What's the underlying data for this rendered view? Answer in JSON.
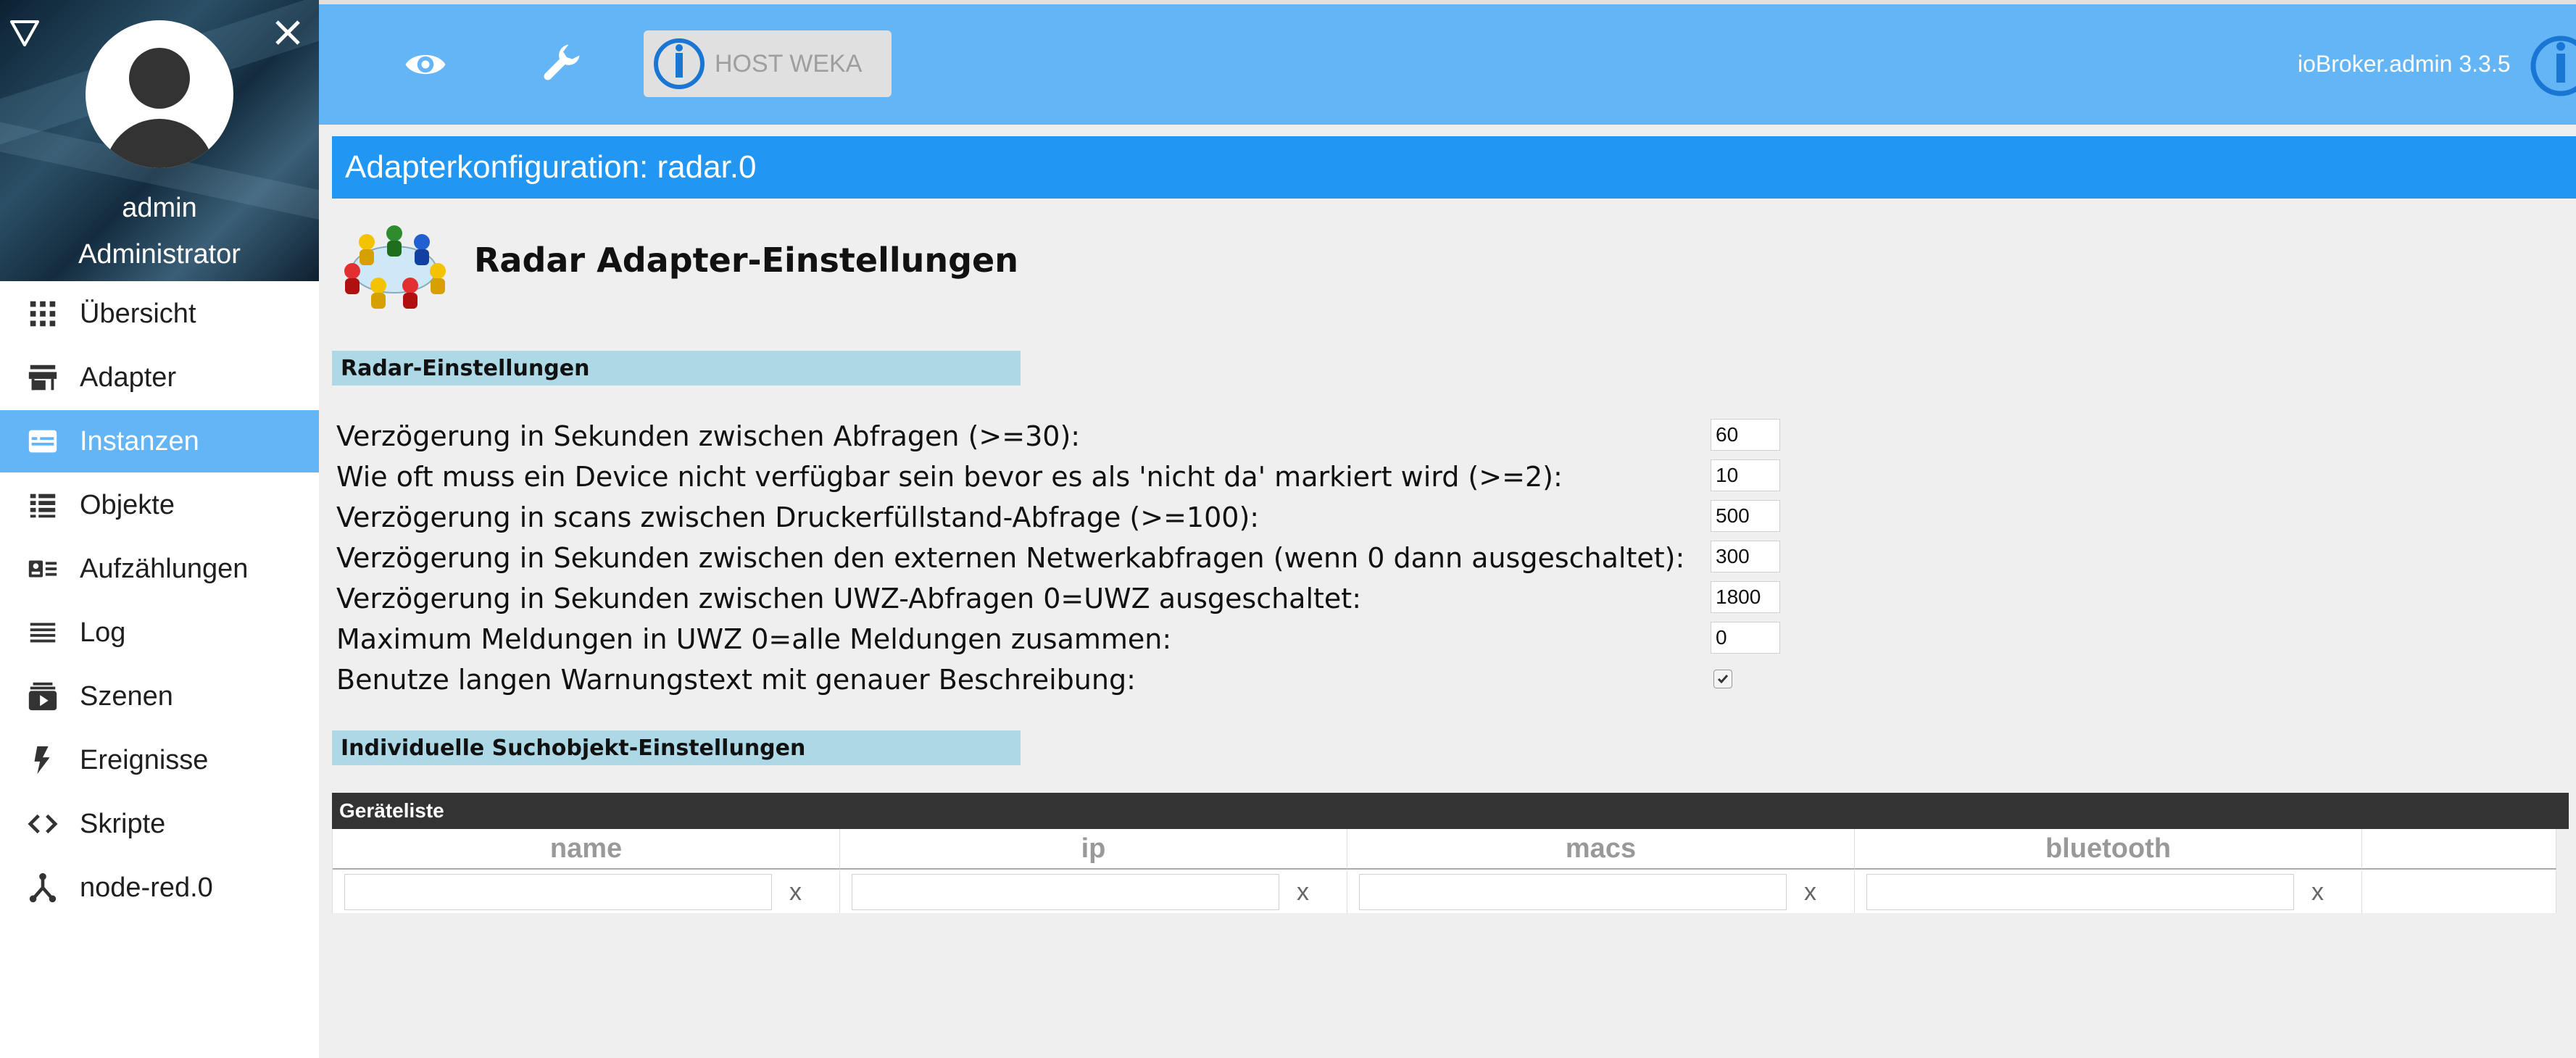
{
  "sidebar": {
    "user_name": "admin",
    "user_role": "Administrator",
    "items": [
      {
        "label": "Übersicht",
        "icon": "grid-icon",
        "active": false
      },
      {
        "label": "Adapter",
        "icon": "store-icon",
        "active": false
      },
      {
        "label": "Instanzen",
        "icon": "instances-icon",
        "active": true
      },
      {
        "label": "Objekte",
        "icon": "list-icon",
        "active": false
      },
      {
        "label": "Aufzählungen",
        "icon": "enum-icon",
        "active": false
      },
      {
        "label": "Log",
        "icon": "log-icon",
        "active": false
      },
      {
        "label": "Szenen",
        "icon": "scenes-icon",
        "active": false
      },
      {
        "label": "Ereignisse",
        "icon": "flash-icon",
        "active": false
      },
      {
        "label": "Skripte",
        "icon": "code-icon",
        "active": false
      },
      {
        "label": "node-red.0",
        "icon": "node-red-icon",
        "active": false
      }
    ]
  },
  "header": {
    "host_label": "HOST WEKA",
    "version": "ioBroker.admin 3.3.5"
  },
  "page": {
    "title": "Adapterkonfiguration: radar.0",
    "adapter_title": "Radar Adapter-Einstellungen"
  },
  "sections": {
    "radar": "Radar-Einstellungen",
    "individual": "Individuelle Suchobjekt-Einstellungen"
  },
  "settings": [
    {
      "label": "Verzögerung in Sekunden zwischen Abfragen (>=30):",
      "value": "60"
    },
    {
      "label": "Wie oft muss ein Device nicht verfügbar sein bevor es als 'nicht da' markiert wird (>=2):",
      "value": "10"
    },
    {
      "label": "Verzögerung in scans zwischen Druckerfüllstand-Abfrage (>=100):",
      "value": "500"
    },
    {
      "label": "Verzögerung in Sekunden zwischen den externen Netwerkabfragen (wenn 0 dann ausgeschaltet):",
      "value": "300"
    },
    {
      "label": "Verzögerung in Sekunden zwischen UWZ-Abfragen 0=UWZ ausgeschaltet:",
      "value": "1800"
    },
    {
      "label": "Maximum Meldungen in UWZ 0=alle Meldungen zusammen:",
      "value": "0"
    },
    {
      "label": "Benutze langen Warnungstext mit genauer Beschreibung:",
      "checked": true
    }
  ],
  "device_table": {
    "title": "Geräteliste",
    "columns": [
      "name",
      "ip",
      "macs",
      "bluetooth"
    ],
    "delete_label": "x"
  },
  "colors": {
    "header": "#64b5f6",
    "titlebar": "#2196f3",
    "section": "#add8e6",
    "active_nav": "#64b5f6"
  }
}
